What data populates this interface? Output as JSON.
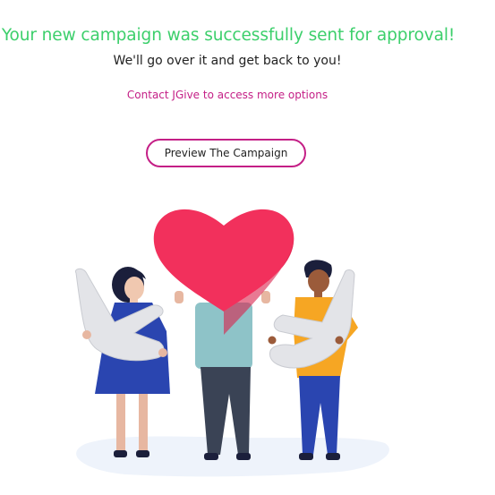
{
  "message": {
    "headline": "Your new campaign was successfully sent for approval!",
    "subline": "We'll go over it and get back to you!"
  },
  "contact_link": {
    "label": "Contact JGive to access more options"
  },
  "preview_button": {
    "label": "Preview The Campaign"
  },
  "illustration": {
    "name": "people-holding-heart-illustration"
  },
  "colors": {
    "success_green": "#3ccf6b",
    "accent_magenta": "#c41f86",
    "heart_red": "#f2305c",
    "text_dark": "#222222"
  }
}
